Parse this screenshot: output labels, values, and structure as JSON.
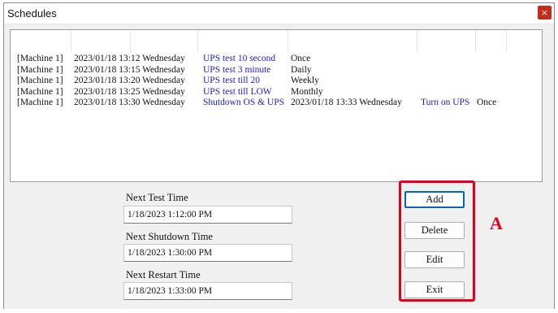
{
  "window": {
    "title": "Schedules",
    "close_glyph": "×"
  },
  "schedule_list": {
    "rows": [
      {
        "machine": "[Machine 1]",
        "datetime": "2023/01/18  13:12  Wednesday",
        "action": "UPS test 10 second",
        "extra_datetime": "",
        "extra_action": "",
        "repeat": "Once"
      },
      {
        "machine": "[Machine 1]",
        "datetime": "2023/01/18  13:15  Wednesday",
        "action": "UPS test 3 minute",
        "extra_datetime": "",
        "extra_action": "",
        "repeat": "Daily"
      },
      {
        "machine": "[Machine 1]",
        "datetime": "2023/01/18  13:20  Wednesday",
        "action": "UPS test till 20",
        "extra_datetime": "",
        "extra_action": "",
        "repeat": "Weekly"
      },
      {
        "machine": "[Machine 1]",
        "datetime": "2023/01/18  13:25  Wednesday",
        "action": "UPS test till LOW",
        "extra_datetime": "",
        "extra_action": "",
        "repeat": "Monthly"
      },
      {
        "machine": "[Machine 1]",
        "datetime": "2023/01/18  13:30  Wednesday",
        "action": "Shutdown OS & UPS",
        "extra_datetime": "2023/01/18  13:33  Wednesday",
        "extra_action": "Turn on UPS",
        "repeat": "Once"
      }
    ]
  },
  "fields": {
    "next_test_label": "Next Test Time",
    "next_test_value": "1/18/2023 1:12:00 PM",
    "next_shutdown_label": "Next Shutdown Time",
    "next_shutdown_value": "1/18/2023 1:30:00 PM",
    "next_restart_label": "Next Restart Time",
    "next_restart_value": "1/18/2023 1:33:00 PM"
  },
  "buttons": {
    "add": "Add",
    "delete": "Delete",
    "edit": "Edit",
    "exit": "Exit"
  },
  "annotation": {
    "marker": "A",
    "color": "#e2001a"
  },
  "colors": {
    "action_text": "#1a1adc",
    "close_button": "#c42b1c",
    "default_button_border": "#0067c0"
  }
}
